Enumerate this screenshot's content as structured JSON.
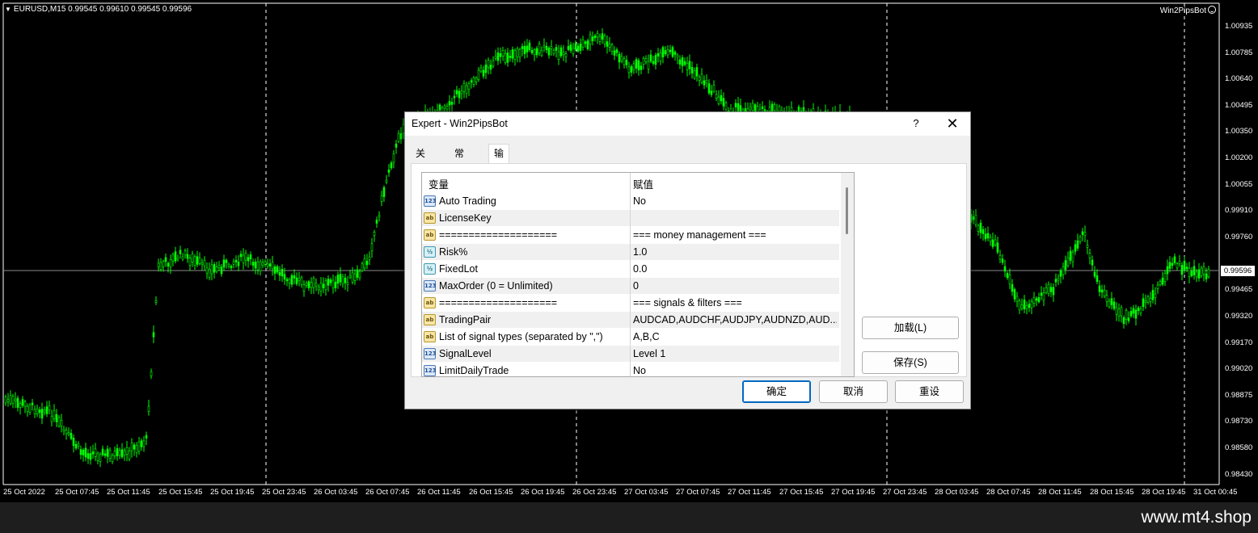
{
  "chart": {
    "symbol_header": "EURUSD,M15  0.99545 0.99610 0.99545 0.99596",
    "bot_label": "Win2PipsBot",
    "smile_icon": "smile-icon",
    "current_price": "0.99596",
    "y_ticks": [
      "1.00935",
      "1.00785",
      "1.00640",
      "1.00495",
      "1.00350",
      "1.00200",
      "1.00055",
      "0.99910",
      "0.99760",
      "0.99465",
      "0.99320",
      "0.99170",
      "0.99020",
      "0.98875",
      "0.98730",
      "0.98580",
      "0.98430"
    ],
    "x_ticks": [
      "25 Oct 2022",
      "25 Oct 07:45",
      "25 Oct 11:45",
      "25 Oct 15:45",
      "25 Oct 19:45",
      "25 Oct 23:45",
      "26 Oct 03:45",
      "26 Oct 07:45",
      "26 Oct 11:45",
      "26 Oct 15:45",
      "26 Oct 19:45",
      "26 Oct 23:45",
      "27 Oct 03:45",
      "27 Oct 07:45",
      "27 Oct 11:45",
      "27 Oct 15:45",
      "27 Oct 19:45",
      "27 Oct 23:45",
      "28 Oct 03:45",
      "28 Oct 07:45",
      "28 Oct 11:45",
      "28 Oct 15:45",
      "28 Oct 19:45",
      "31 Oct 00:45"
    ],
    "candle_color": "#00ff00",
    "background": "#000000"
  },
  "footer": {
    "watermark": "www.mt4.shop"
  },
  "dialog": {
    "title": "Expert - Win2PipsBot",
    "help_label": "?",
    "close_label": "✕",
    "tabs": [
      {
        "label": "关于",
        "active": false
      },
      {
        "label": "常用",
        "active": false
      },
      {
        "label": "输入参数",
        "active": true
      }
    ],
    "grid": {
      "headers": {
        "variable": "变量",
        "value": "赋值"
      },
      "rows": [
        {
          "type": "int",
          "icon": "123",
          "name": "Auto Trading",
          "value": "No"
        },
        {
          "type": "str",
          "icon": "ab",
          "name": "LicenseKey",
          "value": ""
        },
        {
          "type": "str",
          "icon": "ab",
          "name": "====================",
          "value": "=== money management ==="
        },
        {
          "type": "dbl",
          "icon": "½",
          "name": "Risk%",
          "value": "1.0"
        },
        {
          "type": "dbl",
          "icon": "½",
          "name": "FixedLot",
          "value": "0.0"
        },
        {
          "type": "int",
          "icon": "123",
          "name": "MaxOrder (0 = Unlimited)",
          "value": "0"
        },
        {
          "type": "str",
          "icon": "ab",
          "name": "====================",
          "value": "=== signals & filters ==="
        },
        {
          "type": "str",
          "icon": "ab",
          "name": "TradingPair",
          "value": "AUDCAD,AUDCHF,AUDJPY,AUDNZD,AUD..."
        },
        {
          "type": "str",
          "icon": "ab",
          "name": "List of signal types (separated by \",\")",
          "value": "A,B,C"
        },
        {
          "type": "int",
          "icon": "123",
          "name": "SignalLevel",
          "value": "Level 1"
        },
        {
          "type": "int",
          "icon": "123",
          "name": "LimitDailyTrade",
          "value": "No"
        }
      ]
    },
    "buttons": {
      "load": "加载(L)",
      "save": "保存(S)",
      "ok": "确定",
      "cancel": "取消",
      "reset": "重设"
    }
  }
}
